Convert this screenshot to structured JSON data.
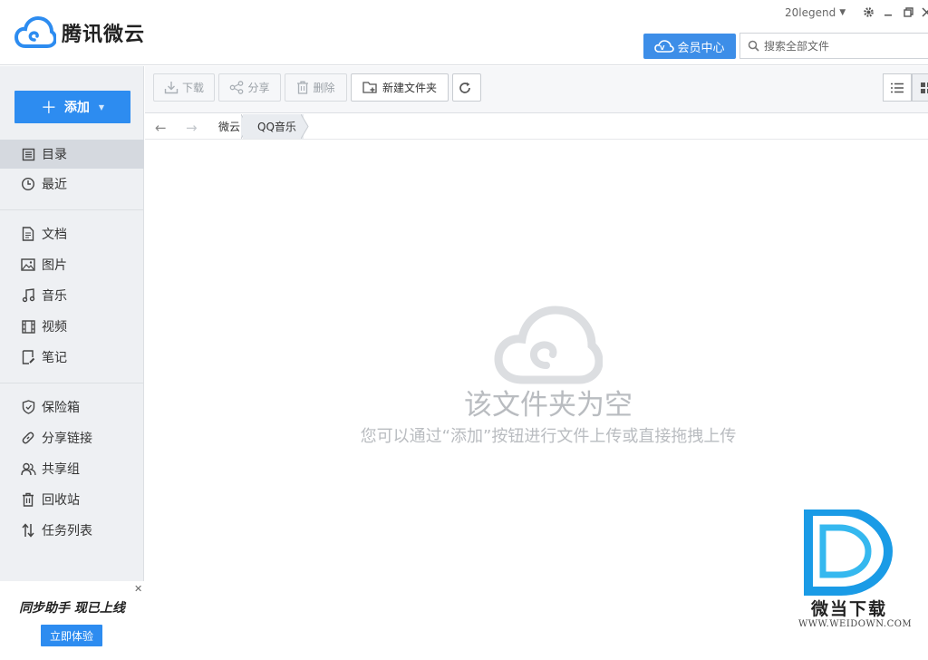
{
  "header": {
    "app_name": "腾讯微云",
    "username": "20legend",
    "vip_label": "会员中心",
    "search_placeholder": "搜索全部文件"
  },
  "sidebar": {
    "add_label": "添加",
    "items": [
      {
        "label": "目录",
        "icon": "catalog-icon",
        "active": true
      },
      {
        "label": "最近",
        "icon": "clock-icon"
      },
      {
        "label": "文档",
        "icon": "document-icon"
      },
      {
        "label": "图片",
        "icon": "image-icon"
      },
      {
        "label": "音乐",
        "icon": "music-icon"
      },
      {
        "label": "视频",
        "icon": "video-icon"
      },
      {
        "label": "笔记",
        "icon": "note-icon"
      },
      {
        "label": "保险箱",
        "icon": "shield-icon"
      },
      {
        "label": "分享链接",
        "icon": "link-icon"
      },
      {
        "label": "共享组",
        "icon": "group-icon"
      },
      {
        "label": "回收站",
        "icon": "trash-icon"
      },
      {
        "label": "任务列表",
        "icon": "transfer-icon"
      }
    ],
    "promo": {
      "title": "同步助手 现已上线",
      "button": "立即体验"
    }
  },
  "toolbar": {
    "download": "下载",
    "share": "分享",
    "delete": "删除",
    "new_folder": "新建文件夹"
  },
  "breadcrumb": [
    "微云",
    "QQ音乐"
  ],
  "empty": {
    "title": "该文件夹为空",
    "subtitle": "您可以通过“添加”按钮进行文件上传或直接拖拽上传"
  },
  "watermark": {
    "name": "微当下载",
    "url": "WWW.WEIDOWN.COM"
  },
  "colors": {
    "accent": "#2d8cf0",
    "vip": "#3d8ee8",
    "sidebar_bg": "#eef0f3",
    "empty_text": "#b9bcc0"
  }
}
